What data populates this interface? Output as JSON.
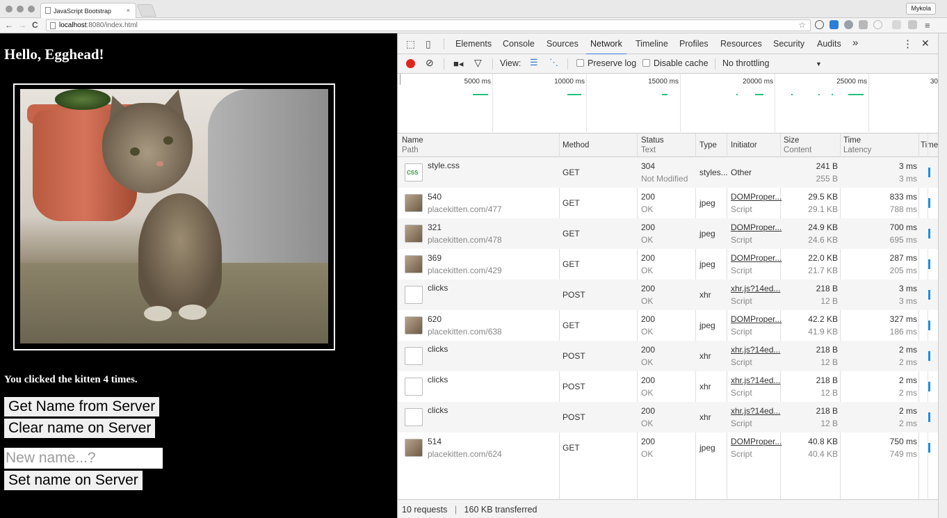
{
  "browser": {
    "tab_title": "JavaScript Bootstrap",
    "tab_close": "×",
    "profile_name": "Mykola",
    "url_host": "localhost",
    "url_rest": ":8080/index.html",
    "nav_back": "←",
    "nav_forward": "→",
    "nav_reload": "C",
    "star": "☆"
  },
  "page": {
    "heading": "Hello, Egghead!",
    "clicked_text": "You clicked the kitten 4 times.",
    "get_name_button": "Get Name from Server",
    "clear_name_button": "Clear name on Server",
    "name_placeholder": "New name...?",
    "set_name_button": "Set name on Server"
  },
  "devtools": {
    "tabs": [
      "Elements",
      "Console",
      "Sources",
      "Network",
      "Timeline",
      "Profiles",
      "Resources",
      "Security",
      "Audits"
    ],
    "active_tab": "Network",
    "more_tabs": "»",
    "menu": "⋮",
    "close": "✕",
    "toolbar": {
      "view_label": "View:",
      "preserve_log": "Preserve log",
      "disable_cache": "Disable cache",
      "throttling": "No throttling",
      "throttling_arrow": "▼"
    },
    "overview_ticks": [
      "5000 ms",
      "10000 ms",
      "15000 ms",
      "20000 ms",
      "25000 ms",
      "30"
    ],
    "columns": {
      "name": "Name",
      "name_sub": "Path",
      "method": "Method",
      "status": "Status",
      "status_sub": "Text",
      "type": "Type",
      "initiator": "Initiator",
      "size": "Size",
      "size_sub": "Content",
      "time": "Time",
      "time_sub": "Latency",
      "timeline": "Timel"
    },
    "requests": [
      {
        "name": "style.css",
        "path": "",
        "method": "GET",
        "status": "304",
        "status_text": "Not Modified",
        "type": "styles...",
        "initiator": "Other",
        "initiator_sub": "",
        "size": "241 B",
        "content": "255 B",
        "time": "3 ms",
        "latency": "3 ms",
        "icon": "css"
      },
      {
        "name": "540",
        "path": "placekitten.com/477",
        "method": "GET",
        "status": "200",
        "status_text": "OK",
        "type": "jpeg",
        "initiator": "DOMProper...",
        "initiator_sub": "Script",
        "size": "29.5 KB",
        "content": "29.1 KB",
        "time": "833 ms",
        "latency": "788 ms",
        "icon": "jpeg"
      },
      {
        "name": "321",
        "path": "placekitten.com/478",
        "method": "GET",
        "status": "200",
        "status_text": "OK",
        "type": "jpeg",
        "initiator": "DOMProper...",
        "initiator_sub": "Script",
        "size": "24.9 KB",
        "content": "24.6 KB",
        "time": "700 ms",
        "latency": "695 ms",
        "icon": "jpeg"
      },
      {
        "name": "369",
        "path": "placekitten.com/429",
        "method": "GET",
        "status": "200",
        "status_text": "OK",
        "type": "jpeg",
        "initiator": "DOMProper...",
        "initiator_sub": "Script",
        "size": "22.0 KB",
        "content": "21.7 KB",
        "time": "287 ms",
        "latency": "205 ms",
        "icon": "jpeg"
      },
      {
        "name": "clicks",
        "path": "",
        "method": "POST",
        "status": "200",
        "status_text": "OK",
        "type": "xhr",
        "initiator": "xhr.js?14ed...",
        "initiator_sub": "Script",
        "size": "218 B",
        "content": "12 B",
        "time": "3 ms",
        "latency": "3 ms",
        "icon": "blank"
      },
      {
        "name": "620",
        "path": "placekitten.com/638",
        "method": "GET",
        "status": "200",
        "status_text": "OK",
        "type": "jpeg",
        "initiator": "DOMProper...",
        "initiator_sub": "Script",
        "size": "42.2 KB",
        "content": "41.9 KB",
        "time": "327 ms",
        "latency": "186 ms",
        "icon": "jpeg"
      },
      {
        "name": "clicks",
        "path": "",
        "method": "POST",
        "status": "200",
        "status_text": "OK",
        "type": "xhr",
        "initiator": "xhr.js?14ed...",
        "initiator_sub": "Script",
        "size": "218 B",
        "content": "12 B",
        "time": "2 ms",
        "latency": "2 ms",
        "icon": "blank"
      },
      {
        "name": "clicks",
        "path": "",
        "method": "POST",
        "status": "200",
        "status_text": "OK",
        "type": "xhr",
        "initiator": "xhr.js?14ed...",
        "initiator_sub": "Script",
        "size": "218 B",
        "content": "12 B",
        "time": "2 ms",
        "latency": "2 ms",
        "icon": "blank"
      },
      {
        "name": "clicks",
        "path": "",
        "method": "POST",
        "status": "200",
        "status_text": "OK",
        "type": "xhr",
        "initiator": "xhr.js?14ed...",
        "initiator_sub": "Script",
        "size": "218 B",
        "content": "12 B",
        "time": "2 ms",
        "latency": "2 ms",
        "icon": "blank"
      },
      {
        "name": "514",
        "path": "placekitten.com/624",
        "method": "GET",
        "status": "200",
        "status_text": "OK",
        "type": "jpeg",
        "initiator": "DOMProper...",
        "initiator_sub": "Script",
        "size": "40.8 KB",
        "content": "40.4 KB",
        "time": "750 ms",
        "latency": "749 ms",
        "icon": "jpeg"
      }
    ],
    "summary_requests": "10 requests",
    "summary_divider": "|",
    "summary_transferred": "160 KB transferred",
    "colors": {
      "record": "#e0261b",
      "active_tab_underline": "#3879d9",
      "timeline_bar": "#1e8fe0",
      "overview_bar": "#1ec27a"
    }
  }
}
